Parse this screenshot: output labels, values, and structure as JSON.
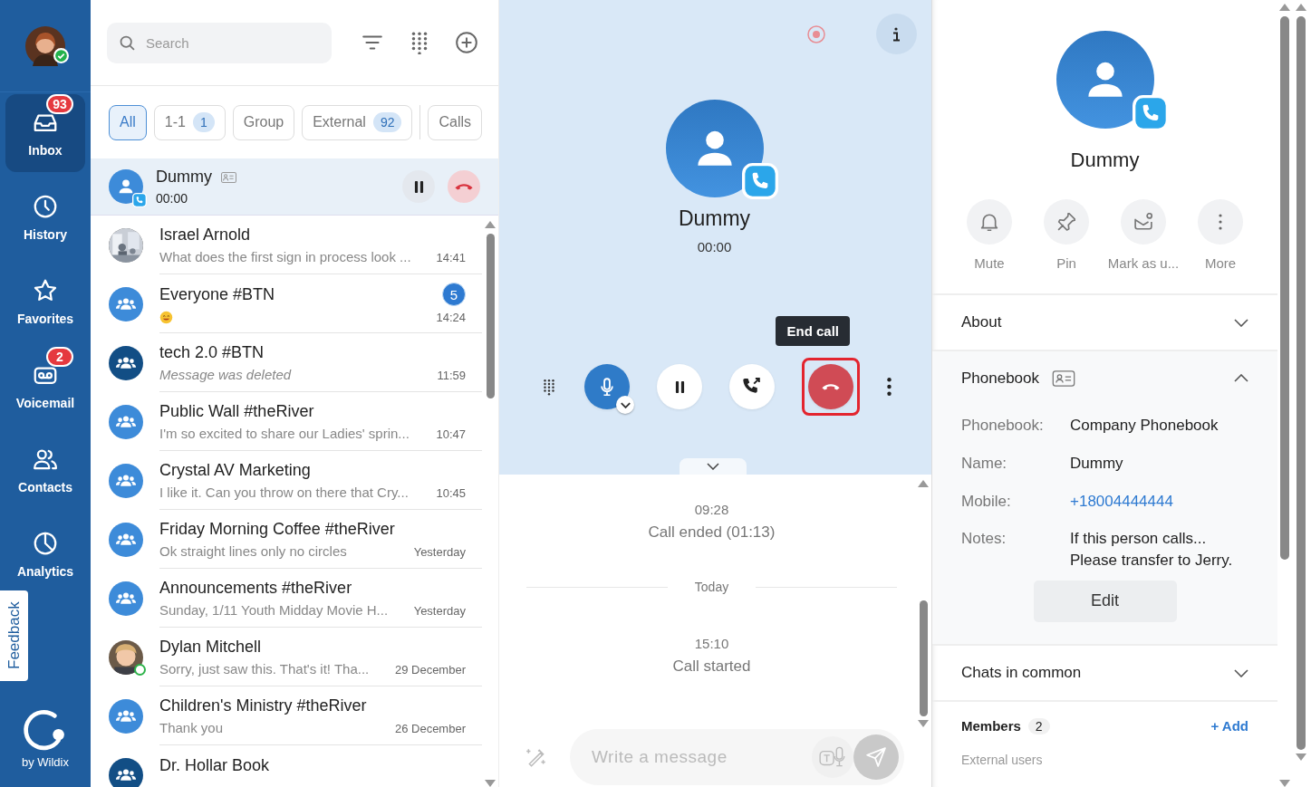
{
  "nav": {
    "items": [
      {
        "label": "Inbox",
        "badge": "93",
        "selected": true
      },
      {
        "label": "History",
        "selected": false
      },
      {
        "label": "Favorites",
        "selected": false
      },
      {
        "label": "Voicemail",
        "badge": "2",
        "selected": false
      },
      {
        "label": "Contacts",
        "selected": false
      },
      {
        "label": "Analytics",
        "selected": false
      }
    ],
    "feedback": "Feedback",
    "brand": "by Wildix",
    "user_online": true
  },
  "search": {
    "placeholder": "Search"
  },
  "filters": [
    {
      "label": "All",
      "selected": true,
      "separated": false
    },
    {
      "label": "1-1",
      "count": "1",
      "selected": false,
      "separated": false
    },
    {
      "label": "Group",
      "selected": false,
      "separated": false
    },
    {
      "label": "External",
      "count": "92",
      "selected": false,
      "separated": false
    },
    {
      "label": "Calls",
      "selected": false,
      "separated": true
    }
  ],
  "active_call": {
    "name": "Dummy",
    "timer": "00:00"
  },
  "conversations": [
    {
      "name": "Israel Arnold",
      "preview": {
        "kind": "text",
        "text": "What does the first sign in process look ..."
      },
      "time": "14:41",
      "online": false
    },
    {
      "name": "Everyone #BTN",
      "preview": {
        "kind": "emoji"
      },
      "time": "14:24",
      "kind": "group",
      "unread": "5",
      "online": false
    },
    {
      "name": "tech 2.0 #BTN",
      "preview": {
        "kind": "deleted",
        "text": "Message was deleted"
      },
      "time": "11:59",
      "kind": "group-dark",
      "online": false
    },
    {
      "name": "Public Wall #theRiver",
      "preview": {
        "kind": "text",
        "text": "I'm so excited to share our Ladies' sprin..."
      },
      "time": "10:47",
      "kind": "group",
      "online": false
    },
    {
      "name": "Crystal AV Marketing",
      "preview": {
        "kind": "text",
        "text": "I like it. Can you throw on there that Cry..."
      },
      "time": "10:45",
      "kind": "group",
      "online": false
    },
    {
      "name": "Friday Morning Coffee #theRiver",
      "preview": {
        "kind": "text",
        "text": "Ok straight lines only no circles"
      },
      "time": "Yesterday",
      "kind": "group",
      "online": false
    },
    {
      "name": "Announcements #theRiver",
      "preview": {
        "kind": "text",
        "text": "Sunday, 1/11 Youth Midday Movie H..."
      },
      "time": "Yesterday",
      "kind": "group",
      "online": false
    },
    {
      "name": "Dylan Mitchell",
      "preview": {
        "kind": "text",
        "text": "Sorry, just saw this. That's it! Tha..."
      },
      "time": "29 December",
      "kind": "photo-child",
      "online": true
    },
    {
      "name": "Children's Ministry #theRiver",
      "preview": {
        "kind": "text",
        "text": "Thank you"
      },
      "time": "26 December",
      "kind": "group",
      "online": false
    },
    {
      "name": "Dr. Hollar Book",
      "kind": "group-dark",
      "online": false
    }
  ],
  "call": {
    "name": "Dummy",
    "timer": "00:00",
    "tooltip": "End call",
    "mic_on": true,
    "recording": true
  },
  "messages": [
    {
      "kind": "event",
      "time": "09:28",
      "text": "Call ended (01:13)"
    },
    {
      "kind": "divider",
      "text": "Today"
    },
    {
      "kind": "event",
      "time": "15:10",
      "text": "Call started"
    }
  ],
  "composer": {
    "placeholder": "Write a message"
  },
  "contact": {
    "name": "Dummy",
    "actions": [
      {
        "label": "Mute"
      },
      {
        "label": "Pin"
      },
      {
        "label": "Mark as u..."
      },
      {
        "label": "More"
      }
    ],
    "sections": [
      {
        "title": "About",
        "expanded": false,
        "card_icon": false
      },
      {
        "title": "Phonebook",
        "expanded": true,
        "card_icon": true,
        "fields": [
          {
            "label": "Phonebook:",
            "value": "Company Phonebook"
          },
          {
            "label": "Name:",
            "value": "Dummy"
          },
          {
            "label": "Mobile:",
            "value": "+18004444444",
            "link": true
          },
          {
            "label": "Notes:",
            "value": "If this person calls...",
            "value2": "Please transfer to Jerry."
          }
        ],
        "button": "Edit"
      },
      {
        "title": "Chats in common",
        "expanded": false,
        "card_icon": false
      }
    ],
    "members": {
      "title": "Members",
      "count": "2",
      "add": "+ Add",
      "subtitle": "External users"
    }
  }
}
